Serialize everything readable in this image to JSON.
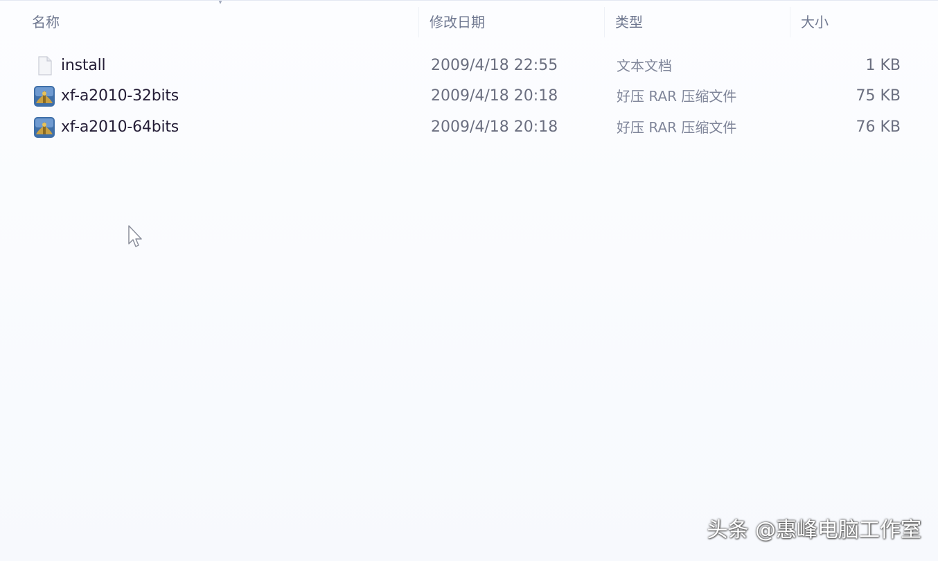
{
  "columns": {
    "name": "名称",
    "date": "修改日期",
    "type": "类型",
    "size": "大小"
  },
  "files": [
    {
      "name": "install",
      "date": "2009/4/18 22:55",
      "type": "文本文档",
      "size": "1 KB",
      "icon": "text-document-icon"
    },
    {
      "name": "xf-a2010-32bits",
      "date": "2009/4/18 20:18",
      "type": "好压 RAR 压缩文件",
      "size": "75 KB",
      "icon": "rar-archive-icon"
    },
    {
      "name": "xf-a2010-64bits",
      "date": "2009/4/18 20:18",
      "type": "好压 RAR 压缩文件",
      "size": "76 KB",
      "icon": "rar-archive-icon"
    }
  ],
  "watermark": "头条 @惠峰电脑工作室",
  "colors": {
    "background": "#fbfcfe",
    "header_text": "#6f7890",
    "name_text": "#241d36",
    "detail_text": "#6b6f80"
  }
}
